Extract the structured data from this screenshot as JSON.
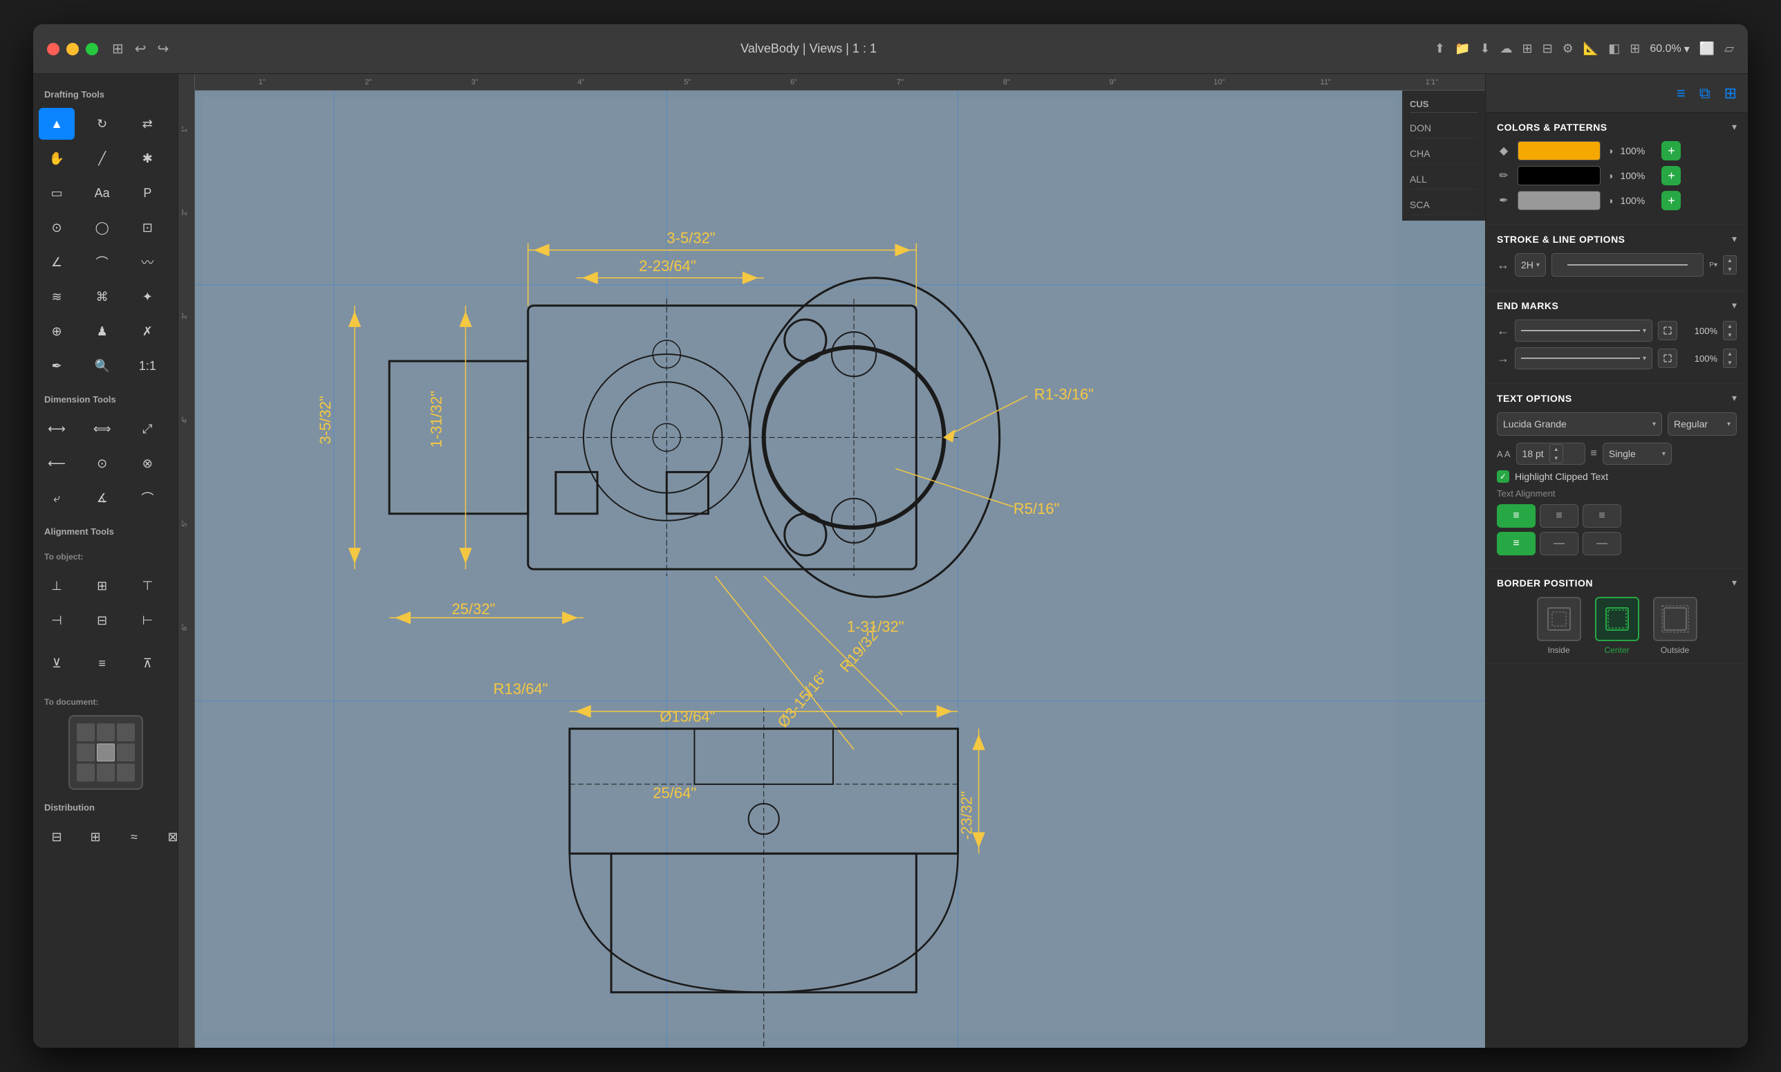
{
  "window": {
    "title": "ValveBody | Views | 1 : 1",
    "zoom": "60.0%"
  },
  "titlebar": {
    "undo_label": "↩",
    "redo_label": "↪",
    "sidebar_icon": "□",
    "title": "ValveBody | Views | 1 : 1"
  },
  "sidebar": {
    "drafting_tools_label": "Drafting Tools",
    "dimension_tools_label": "Dimension Tools",
    "alignment_tools_label": "Alignment Tools",
    "to_object_label": "To object:",
    "to_document_label": "To document:",
    "distribution_label": "Distribution"
  },
  "right_panel": {
    "colors_patterns_label": "COLORS & PATTERNS",
    "colors": [
      {
        "id": "fill",
        "icon": "◆",
        "color": "#f5a800",
        "opacity": "100%"
      },
      {
        "id": "stroke",
        "icon": "✏",
        "color": "#000000",
        "opacity": "100%"
      },
      {
        "id": "shadow",
        "icon": "✒",
        "color": "#999999",
        "opacity": "100%"
      }
    ],
    "stroke_line_options_label": "STROKE & LINE OPTIONS",
    "stroke_value": "2H",
    "end_marks_label": "END MARKS",
    "end_mark_1_pct": "100%",
    "end_mark_2_pct": "100%",
    "text_options_label": "TEXT OPTIONS",
    "font_name": "Lucida Grande",
    "font_style": "Regular",
    "font_size": "18 pt",
    "line_spacing": "Single",
    "highlight_clipped_text": "Highlight Clipped Text",
    "text_alignment_label": "Text Alignment",
    "border_position_label": "BORDER POSITION",
    "border_positions": [
      {
        "id": "inside",
        "label": "Inside",
        "active": false
      },
      {
        "id": "center",
        "label": "Center",
        "active": true
      },
      {
        "id": "outside",
        "label": "Outside",
        "active": false
      }
    ]
  },
  "ruler_marks": [
    "1\"",
    "2\"",
    "3\"",
    "4\"",
    "5\"",
    "6\"",
    "7\"",
    "8\"",
    "9\"",
    "10\"",
    "11\"",
    "1'1\""
  ],
  "cust_panel": {
    "items": [
      "DON",
      "CHA",
      "ALL",
      "SCA"
    ]
  }
}
